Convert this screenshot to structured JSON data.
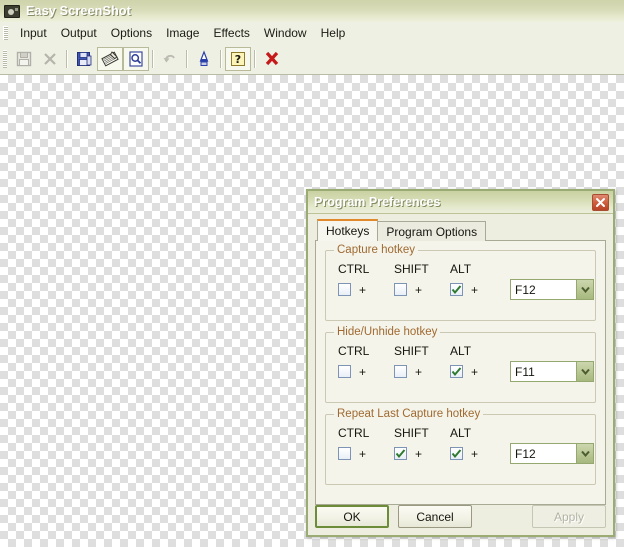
{
  "window": {
    "title": "Easy ScreenShot",
    "icon": "camera-icon"
  },
  "menubar": {
    "items": [
      {
        "label": "Input"
      },
      {
        "label": "Output"
      },
      {
        "label": "Options"
      },
      {
        "label": "Image"
      },
      {
        "label": "Effects"
      },
      {
        "label": "Window"
      },
      {
        "label": "Help"
      }
    ]
  },
  "toolbar": {
    "buttons": [
      {
        "icon": "save-icon",
        "enabled": false
      },
      {
        "icon": "close-x-icon",
        "enabled": false
      },
      {
        "icon": "save-as-icon",
        "enabled": true
      },
      {
        "icon": "capture-region-icon",
        "enabled": true
      },
      {
        "icon": "preview-page-icon",
        "enabled": true
      },
      {
        "icon": "undo-icon",
        "enabled": false
      },
      {
        "icon": "color-picker-icon",
        "enabled": true
      },
      {
        "icon": "help-question-icon",
        "enabled": true
      },
      {
        "icon": "exit-red-x-icon",
        "enabled": true
      }
    ]
  },
  "dialog": {
    "title": "Program Preferences",
    "close_label": "Close",
    "tabs": [
      {
        "label": "Hotkeys",
        "active": true
      },
      {
        "label": "Program Options",
        "active": false
      }
    ],
    "groups": [
      {
        "label": "Capture hotkey",
        "modifiers": [
          {
            "label": "CTRL",
            "checked": false
          },
          {
            "label": "SHIFT",
            "checked": false
          },
          {
            "label": "ALT",
            "checked": true
          }
        ],
        "separator": "+",
        "key": "F12"
      },
      {
        "label": "Hide/Unhide hotkey",
        "modifiers": [
          {
            "label": "CTRL",
            "checked": false
          },
          {
            "label": "SHIFT",
            "checked": false
          },
          {
            "label": "ALT",
            "checked": true
          }
        ],
        "separator": "+",
        "key": "F11"
      },
      {
        "label": "Repeat Last Capture hotkey",
        "modifiers": [
          {
            "label": "CTRL",
            "checked": false
          },
          {
            "label": "SHIFT",
            "checked": true
          },
          {
            "label": "ALT",
            "checked": true
          }
        ],
        "separator": "+",
        "key": "F12"
      }
    ],
    "buttons": {
      "ok": "OK",
      "cancel": "Cancel",
      "apply": "Apply",
      "apply_enabled": false
    }
  },
  "colors": {
    "titlebar_green": "#d8dcb8",
    "accent_orange": "#e08a2b",
    "group_label_brown": "#a06a32",
    "ok_focus_green": "#6d8c3a",
    "close_red": "#cf5f40"
  }
}
